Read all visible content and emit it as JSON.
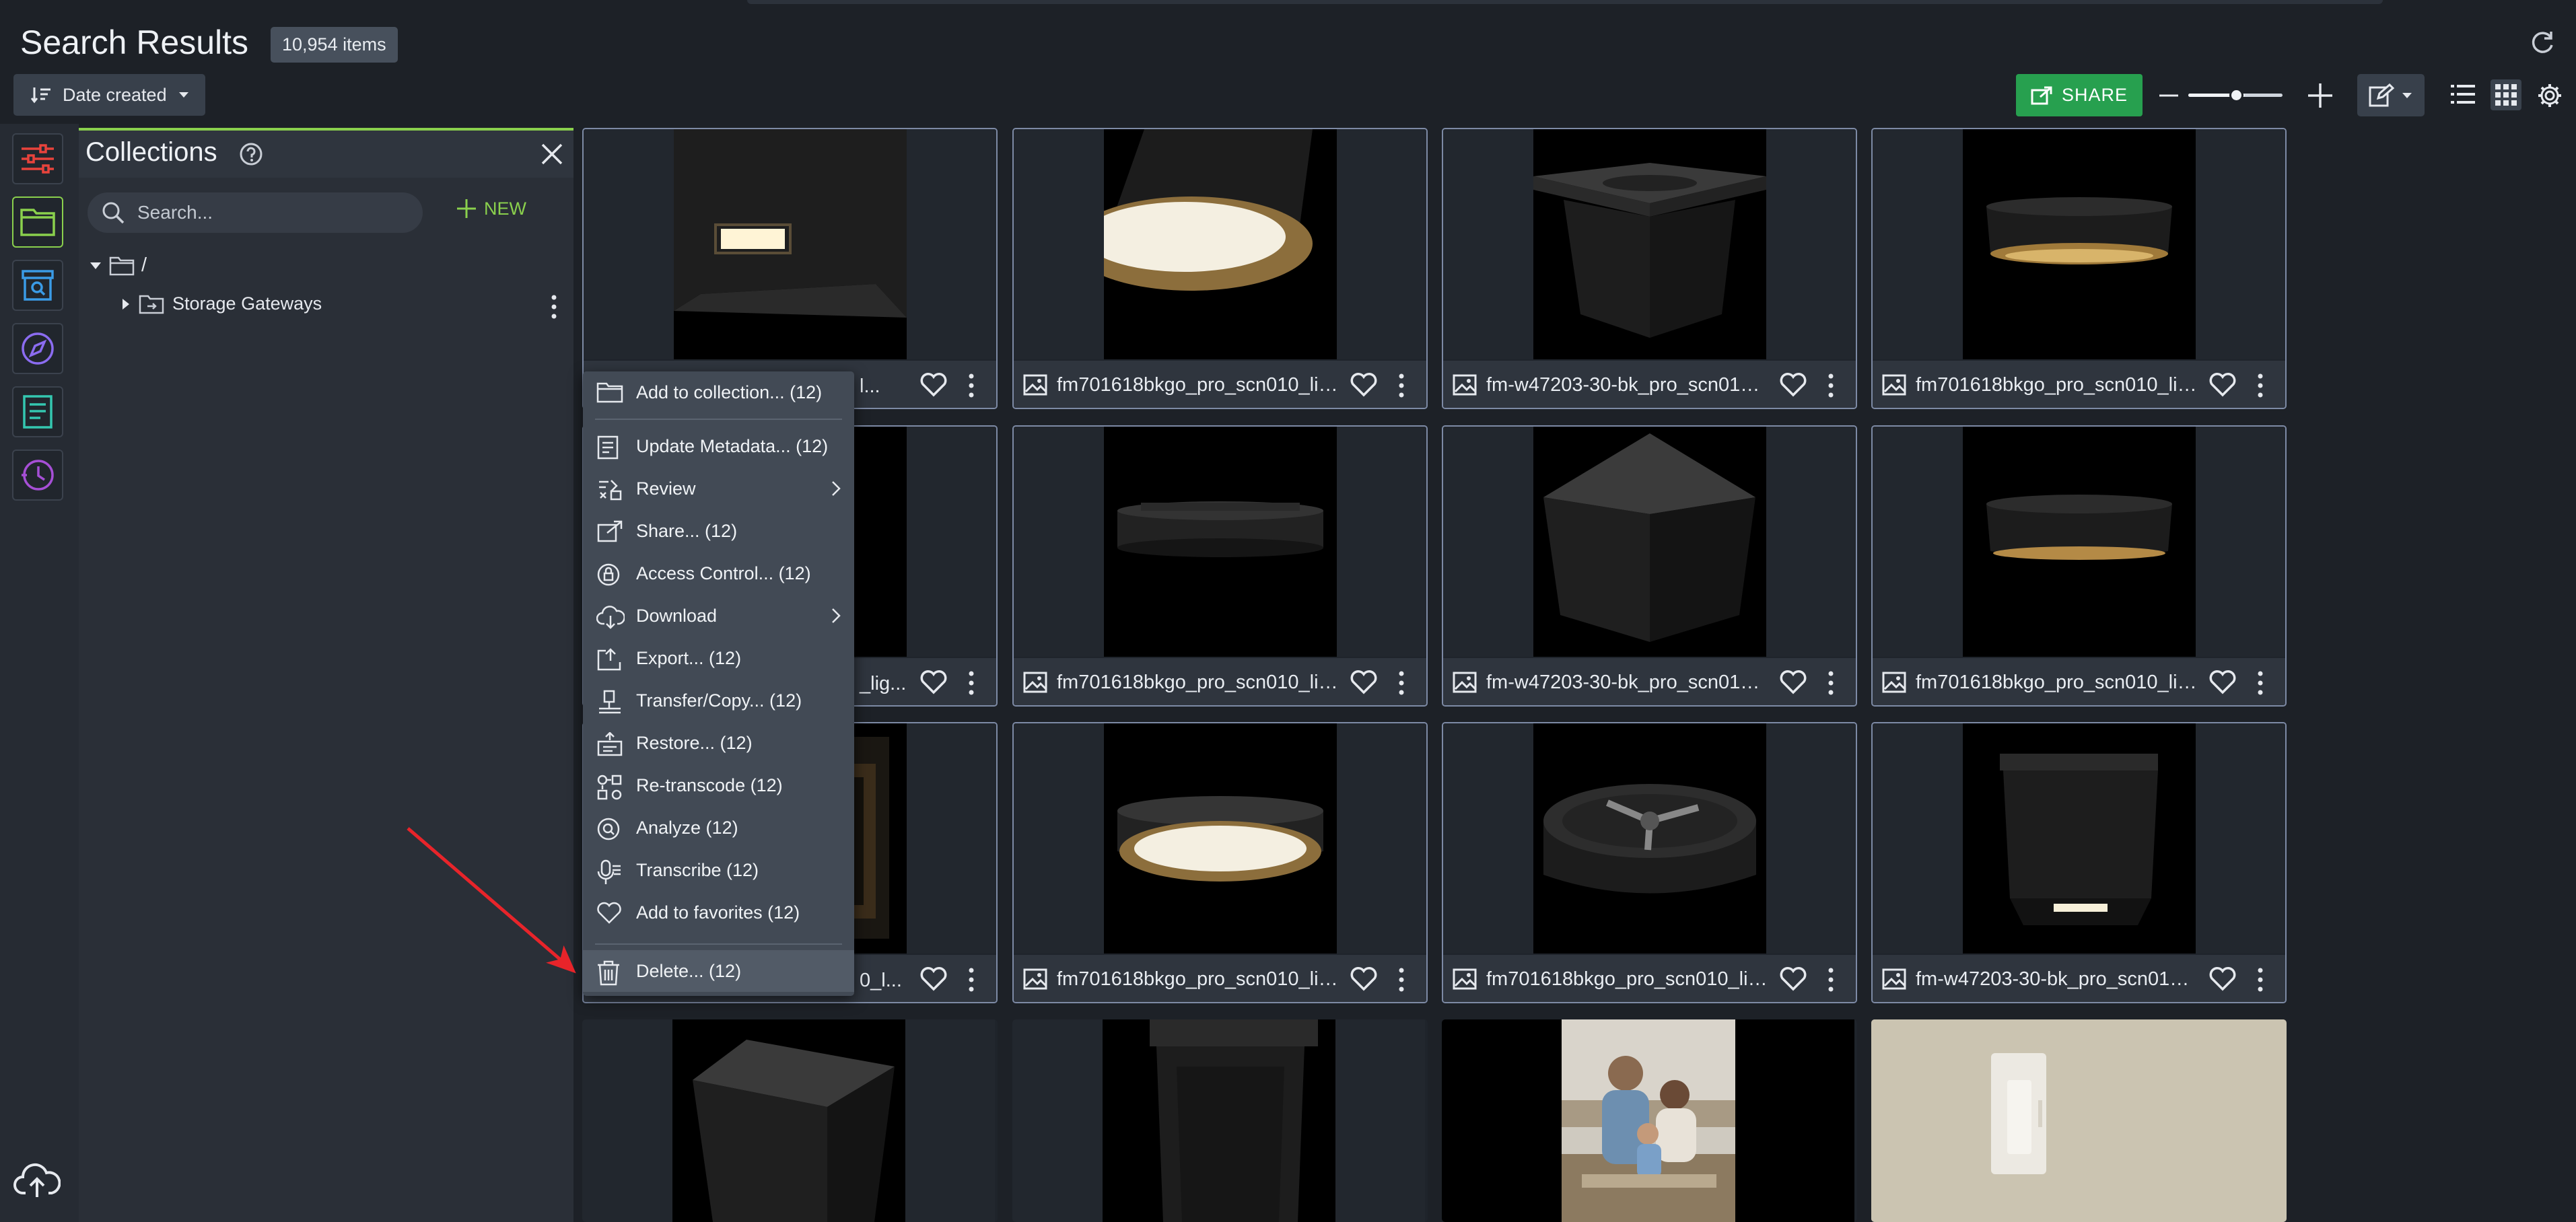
{
  "header": {
    "title": "Search Results",
    "count_badge": "10,954 items",
    "sort_label": "Date created",
    "share_label": "SHARE",
    "zoom_level": 0.6
  },
  "panel": {
    "title": "Collections",
    "search_placeholder": "Search...",
    "new_label": "NEW",
    "tree": {
      "root_label": "/",
      "child_label": "Storage Gateways"
    }
  },
  "tiles": [
    {
      "name": "fm701618bkgo_pro_scn010_lig...",
      "partial": "l..."
    },
    {
      "name": "fm701618bkgo_pro_scn010_lig..."
    },
    {
      "name": "fm-w47203-30-bk_pro_scn010_l..."
    },
    {
      "name": "fm701618bkgo_pro_scn010_lig..."
    },
    {
      "name": "fm701618bkgo_pro_scn010_lig...",
      "partial": "_lig..."
    },
    {
      "name": "fm701618bkgo_pro_scn010_lig..."
    },
    {
      "name": "fm-w47203-30-bk_pro_scn010_l..."
    },
    {
      "name": "fm701618bkgo_pro_scn010_lig..."
    },
    {
      "name": "fm701618bkgo_pro_scn010_lig...",
      "partial": "0_l..."
    },
    {
      "name": "fm701618bkgo_pro_scn010_lig..."
    },
    {
      "name": "fm701618bkgo_pro_scn010_lig..."
    },
    {
      "name": "fm-w47203-30-bk_pro_scn010_l..."
    }
  ],
  "menu": {
    "items": [
      {
        "label": "Add to collection... (12)",
        "icon": "folder-icon"
      },
      {
        "label": "Update Metadata... (12)",
        "icon": "document-icon"
      },
      {
        "label": "Review",
        "icon": "review-icon",
        "submenu": true
      },
      {
        "label": "Share... (12)",
        "icon": "share-icon"
      },
      {
        "label": "Access Control... (12)",
        "icon": "lock-icon"
      },
      {
        "label": "Download",
        "icon": "cloud-download-icon",
        "submenu": true
      },
      {
        "label": "Export... (12)",
        "icon": "export-icon"
      },
      {
        "label": "Transfer/Copy... (12)",
        "icon": "transfer-icon"
      },
      {
        "label": "Restore... (12)",
        "icon": "restore-icon"
      },
      {
        "label": "Re-transcode (12)",
        "icon": "transcode-icon"
      },
      {
        "label": "Analyze (12)",
        "icon": "analyze-icon"
      },
      {
        "label": "Transcribe (12)",
        "icon": "transcribe-icon"
      },
      {
        "label": "Add to favorites (12)",
        "icon": "heart-icon"
      },
      {
        "label": "Delete... (12)",
        "icon": "trash-icon"
      }
    ]
  },
  "colors": {
    "accent_green": "#27a04f",
    "panel_accent": "#8ad04d",
    "annotation_arrow": "#e8242a"
  }
}
